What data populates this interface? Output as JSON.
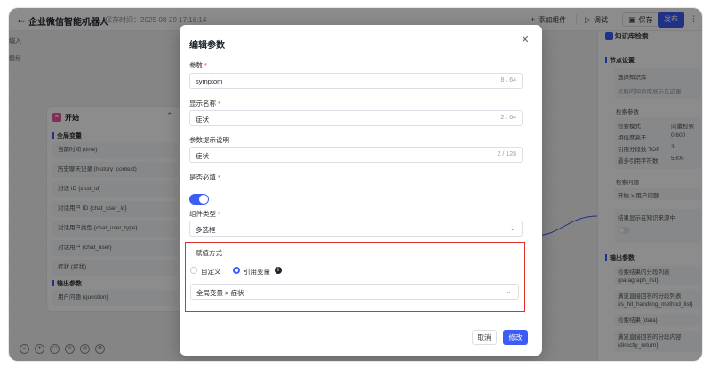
{
  "header": {
    "back_icon": "arrow-left-icon",
    "title": "企业微信智能机器人",
    "save_time": "保存时间：2025-08-29 17:16:14",
    "add_component": "添加组件",
    "debug": "调试",
    "save": "保存",
    "publish": "发布"
  },
  "canvas": {
    "frag_left_1": "编入",
    "frag_left_2": "骰段"
  },
  "start_node": {
    "title": "开始",
    "section_global": "全局变量",
    "globals": [
      "当前时间 {time}",
      "历史聊天记录 {history_context}",
      "对话 ID {chat_id}",
      "对话用户 ID {chat_user_id}",
      "对话用户类型 {chat_user_type}",
      "对话用户 {chat_user}",
      "症状 {症状}"
    ],
    "section_output": "输出参数",
    "outputs": [
      "用户问题 {question}"
    ]
  },
  "panel": {
    "title": "知识库检索",
    "node_settings": "节点设置",
    "select_kb": "选择知识库",
    "kb_hint": "关联的知识库展示在这里",
    "search_params": "检索参数",
    "rows": [
      {
        "k": "检索模式",
        "v": "向量检索"
      },
      {
        "k": "相似度高于",
        "v": "0.600"
      },
      {
        "k": "引用分段数 TOP",
        "v": "3"
      },
      {
        "k": "最多引用字符数",
        "v": "5000"
      }
    ],
    "search_question": "检索问题",
    "question_value": "开始 > 用户问题",
    "show_result": "结果显示在知识来源中",
    "output_params": "输出参数",
    "outputs": [
      "检索结果的分段列表 {paragraph_list}",
      "满足直接回答的分段列表 {is_hit_handling_method_list}",
      "检索结果 {data}",
      "满足直接回答的分段内容 {directly_return}"
    ]
  },
  "modal": {
    "title": "编辑参数",
    "param_label": "参数",
    "param_value": "symptom",
    "param_count": "8 / 64",
    "display_label": "显示名称",
    "display_value": "症状",
    "display_count": "2 / 64",
    "hint_label": "参数提示说明",
    "hint_value": "症状",
    "hint_count": "2 / 128",
    "required_label": "是否必填",
    "required": true,
    "type_label": "组件类型",
    "type_value": "多选框",
    "assign_label": "赋值方式",
    "option_custom": "自定义",
    "option_reference": "引用变量",
    "selected_option": "引用变量",
    "reference_value": "全局变量 > 症状",
    "cancel": "取消",
    "confirm": "修改"
  },
  "colors": {
    "primary": "#3d5cf5",
    "highlight_border": "#e0302b",
    "start_icon": "#e8559b"
  }
}
